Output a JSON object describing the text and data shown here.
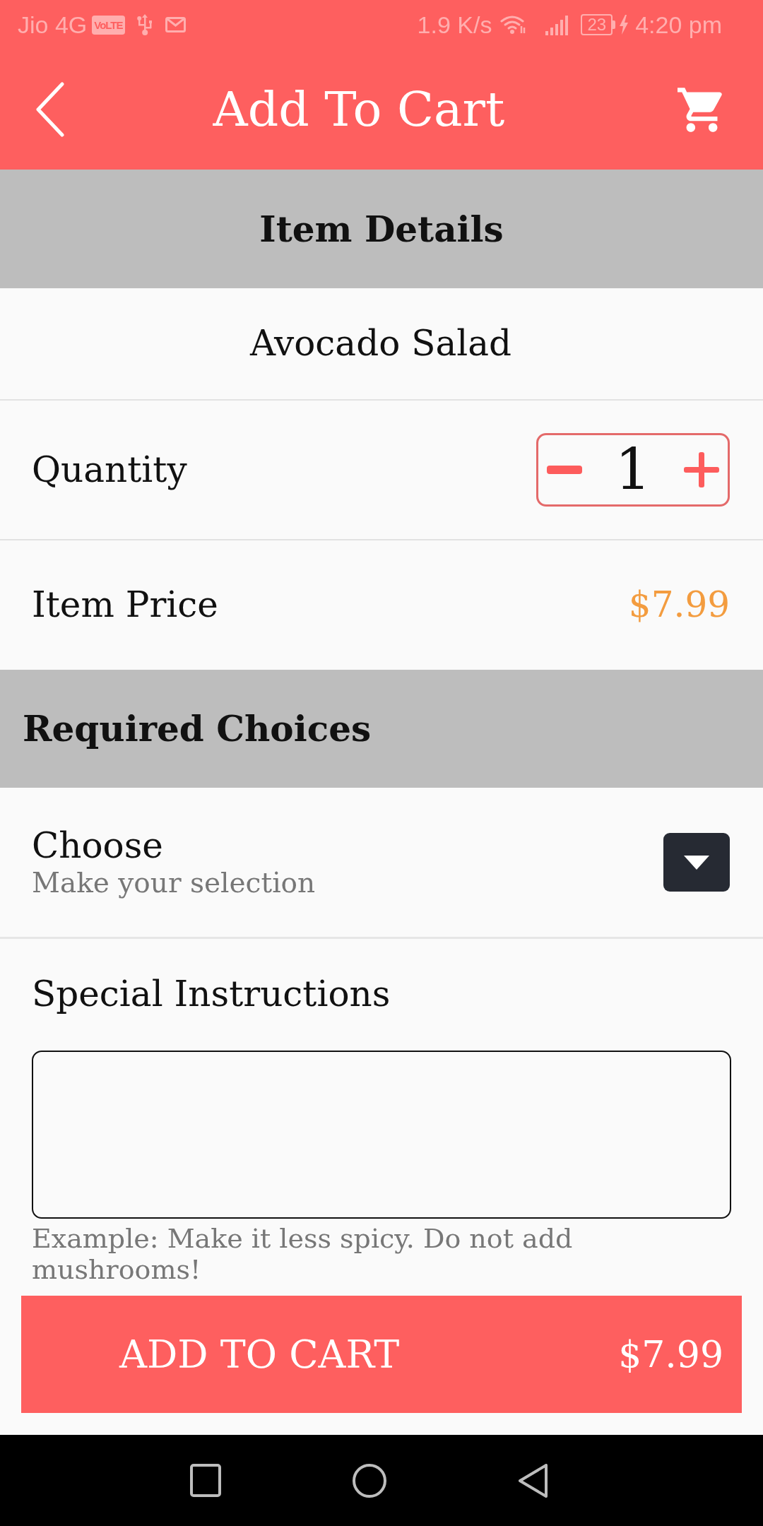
{
  "status_bar": {
    "carrier": "Jio 4G",
    "network_badge": "VoLTE",
    "speed": "1.9 K/s",
    "battery": "23",
    "charging": true,
    "time": "4:20 pm"
  },
  "app_bar": {
    "title": "Add To Cart"
  },
  "item_details": {
    "heading": "Item Details",
    "name": "Avocado Salad",
    "quantity": {
      "label": "Quantity",
      "value": "1"
    },
    "price": {
      "label": "Item Price",
      "value": "$7.99"
    }
  },
  "required_choices": {
    "heading": "Required Choices",
    "choices": [
      {
        "label": "Choose",
        "hint": "Make your selection"
      }
    ]
  },
  "special_instructions": {
    "label": "Special Instructions",
    "example": "Example: Make it less spicy. Do not add mushrooms!"
  },
  "add_to_cart_button": {
    "label": "ADD TO CART",
    "total": "$7.99"
  }
}
